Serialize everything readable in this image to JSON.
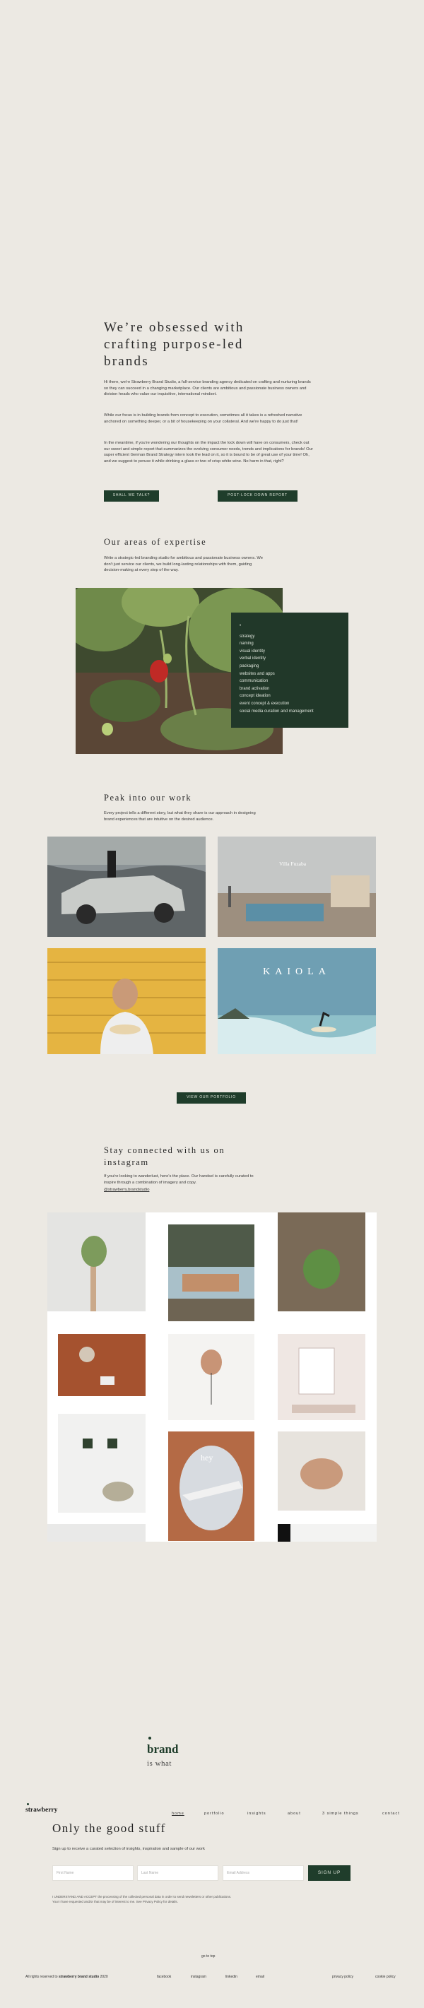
{
  "intro": {
    "title_lines": [
      "We’re obsessed with",
      "crafting purpose-led",
      "brands"
    ],
    "p1": "Hi there, we're Strawberry Brand Studio, a full-service branding agency dedicated on crafting and nurturing brands so they can succeed in a changing marketplace. Our clients are ambitious and passionate business owners and division heads who value our inquisitive, international mindset.",
    "p2": "While our focus is in building brands from concept to execution, sometimes all it takes is a refreshed narrative anchored on something deeper, or a bit of housekeeping on your collateral. And we're happy to do just that!",
    "p3": "In the meantime, if you're wondering our thoughts on the impact the lock down will have on consumers, check out our sweet and simple report that summarizes the evolving consumer needs, trends and implications for brands! Our super efficient German Brand Strategy intern took the lead on it, so it is bound to be of great use of your time! Oh, and we suggest to peruse it while drinking a glass or two of crisp white wine. No harm in that, right?",
    "btn_talk": "SHALL WE TALK?",
    "btn_report": "POST-LOCK DOWN REPORT"
  },
  "expertise": {
    "title": "Our areas of expertise",
    "desc": "Write a strategic-led branding studio for ambitious and passionate business owners. We don't just service our clients, we build long-lasting relationships with them, guiding decision-making at every step of the way.",
    "bullet": "•",
    "items": [
      "strategy",
      "naming",
      "visual identity",
      "verbal identity",
      "packaging",
      "websites and apps",
      "communication",
      "brand activation",
      "concept ideation",
      "event concept & execution",
      "social media curation and management"
    ]
  },
  "work": {
    "title": "Peak into our work",
    "desc": "Every project tells a different story, but what they share is our approach in designing brand experiences that are intuitive on the desired audience.",
    "villa_logo": "Villa Fuzaba",
    "kaiola": "KAIOLA",
    "btn_portfolio": "VIEW OUR PORTFOLIO"
  },
  "instagram": {
    "title_lines": [
      "Stay connected with us on",
      "instagram"
    ],
    "desc": "If you're looking to wanderlust, here's the place. Our handsel is carefully curated to inspire through a combination of imagery and copy.",
    "handle": "@strawberry.brandstudio",
    "hey_text": "hey"
  },
  "brand_card": {
    "brand": "brand",
    "is_what": "is what"
  },
  "nav": {
    "logo": "strawberry",
    "items": [
      "home",
      "portfolio",
      "insights",
      "about",
      "3 simple things",
      "contact"
    ]
  },
  "newsletter": {
    "title": "Only the good stuff",
    "desc": "Sign up to receive a curated selection of insights, inspiration and sample of our work",
    "first_name": "First Name",
    "last_name": "Last Name",
    "email": "Email Address",
    "signup": "SIGN UP",
    "consent1": "I UNDERSTAND AND ACCEPT the processing of the collected personal data in order to send newsletters or other publications.",
    "consent2": "Your I have requested and/or that may be of interest to me. See Privacy Policy for details."
  },
  "footer": {
    "go_to_top": "go to top",
    "copyright_prefix": "All rights reserved to ",
    "copyright_brand": "strawberry brand studio",
    "copyright_year": " 2020",
    "links": [
      "facebook",
      "instagram",
      "linkedin",
      "email"
    ],
    "privacy": "privacy policy",
    "cookie": "cookie policy"
  },
  "colors": {
    "background": "#ece9e3",
    "accent": "#1f3d2b",
    "panel": "#213829"
  }
}
